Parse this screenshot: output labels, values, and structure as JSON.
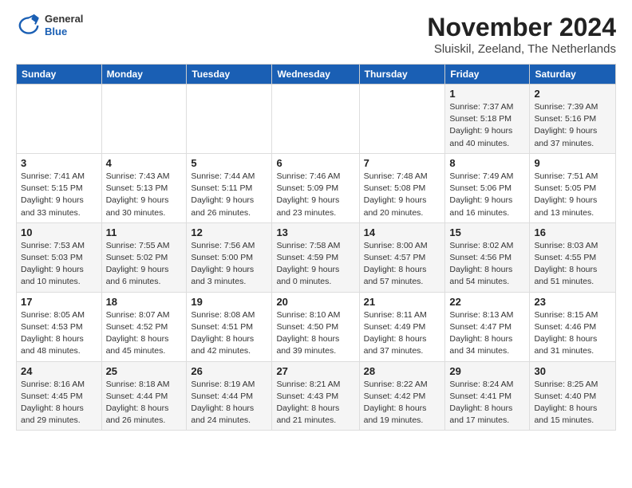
{
  "header": {
    "logo": {
      "general": "General",
      "blue": "Blue"
    },
    "title": "November 2024",
    "subtitle": "Sluiskil, Zeeland, The Netherlands"
  },
  "weekdays": [
    "Sunday",
    "Monday",
    "Tuesday",
    "Wednesday",
    "Thursday",
    "Friday",
    "Saturday"
  ],
  "weeks": [
    [
      {
        "day": "",
        "info": ""
      },
      {
        "day": "",
        "info": ""
      },
      {
        "day": "",
        "info": ""
      },
      {
        "day": "",
        "info": ""
      },
      {
        "day": "",
        "info": ""
      },
      {
        "day": "1",
        "info": "Sunrise: 7:37 AM\nSunset: 5:18 PM\nDaylight: 9 hours\nand 40 minutes."
      },
      {
        "day": "2",
        "info": "Sunrise: 7:39 AM\nSunset: 5:16 PM\nDaylight: 9 hours\nand 37 minutes."
      }
    ],
    [
      {
        "day": "3",
        "info": "Sunrise: 7:41 AM\nSunset: 5:15 PM\nDaylight: 9 hours\nand 33 minutes."
      },
      {
        "day": "4",
        "info": "Sunrise: 7:43 AM\nSunset: 5:13 PM\nDaylight: 9 hours\nand 30 minutes."
      },
      {
        "day": "5",
        "info": "Sunrise: 7:44 AM\nSunset: 5:11 PM\nDaylight: 9 hours\nand 26 minutes."
      },
      {
        "day": "6",
        "info": "Sunrise: 7:46 AM\nSunset: 5:09 PM\nDaylight: 9 hours\nand 23 minutes."
      },
      {
        "day": "7",
        "info": "Sunrise: 7:48 AM\nSunset: 5:08 PM\nDaylight: 9 hours\nand 20 minutes."
      },
      {
        "day": "8",
        "info": "Sunrise: 7:49 AM\nSunset: 5:06 PM\nDaylight: 9 hours\nand 16 minutes."
      },
      {
        "day": "9",
        "info": "Sunrise: 7:51 AM\nSunset: 5:05 PM\nDaylight: 9 hours\nand 13 minutes."
      }
    ],
    [
      {
        "day": "10",
        "info": "Sunrise: 7:53 AM\nSunset: 5:03 PM\nDaylight: 9 hours\nand 10 minutes."
      },
      {
        "day": "11",
        "info": "Sunrise: 7:55 AM\nSunset: 5:02 PM\nDaylight: 9 hours\nand 6 minutes."
      },
      {
        "day": "12",
        "info": "Sunrise: 7:56 AM\nSunset: 5:00 PM\nDaylight: 9 hours\nand 3 minutes."
      },
      {
        "day": "13",
        "info": "Sunrise: 7:58 AM\nSunset: 4:59 PM\nDaylight: 9 hours\nand 0 minutes."
      },
      {
        "day": "14",
        "info": "Sunrise: 8:00 AM\nSunset: 4:57 PM\nDaylight: 8 hours\nand 57 minutes."
      },
      {
        "day": "15",
        "info": "Sunrise: 8:02 AM\nSunset: 4:56 PM\nDaylight: 8 hours\nand 54 minutes."
      },
      {
        "day": "16",
        "info": "Sunrise: 8:03 AM\nSunset: 4:55 PM\nDaylight: 8 hours\nand 51 minutes."
      }
    ],
    [
      {
        "day": "17",
        "info": "Sunrise: 8:05 AM\nSunset: 4:53 PM\nDaylight: 8 hours\nand 48 minutes."
      },
      {
        "day": "18",
        "info": "Sunrise: 8:07 AM\nSunset: 4:52 PM\nDaylight: 8 hours\nand 45 minutes."
      },
      {
        "day": "19",
        "info": "Sunrise: 8:08 AM\nSunset: 4:51 PM\nDaylight: 8 hours\nand 42 minutes."
      },
      {
        "day": "20",
        "info": "Sunrise: 8:10 AM\nSunset: 4:50 PM\nDaylight: 8 hours\nand 39 minutes."
      },
      {
        "day": "21",
        "info": "Sunrise: 8:11 AM\nSunset: 4:49 PM\nDaylight: 8 hours\nand 37 minutes."
      },
      {
        "day": "22",
        "info": "Sunrise: 8:13 AM\nSunset: 4:47 PM\nDaylight: 8 hours\nand 34 minutes."
      },
      {
        "day": "23",
        "info": "Sunrise: 8:15 AM\nSunset: 4:46 PM\nDaylight: 8 hours\nand 31 minutes."
      }
    ],
    [
      {
        "day": "24",
        "info": "Sunrise: 8:16 AM\nSunset: 4:45 PM\nDaylight: 8 hours\nand 29 minutes."
      },
      {
        "day": "25",
        "info": "Sunrise: 8:18 AM\nSunset: 4:44 PM\nDaylight: 8 hours\nand 26 minutes."
      },
      {
        "day": "26",
        "info": "Sunrise: 8:19 AM\nSunset: 4:44 PM\nDaylight: 8 hours\nand 24 minutes."
      },
      {
        "day": "27",
        "info": "Sunrise: 8:21 AM\nSunset: 4:43 PM\nDaylight: 8 hours\nand 21 minutes."
      },
      {
        "day": "28",
        "info": "Sunrise: 8:22 AM\nSunset: 4:42 PM\nDaylight: 8 hours\nand 19 minutes."
      },
      {
        "day": "29",
        "info": "Sunrise: 8:24 AM\nSunset: 4:41 PM\nDaylight: 8 hours\nand 17 minutes."
      },
      {
        "day": "30",
        "info": "Sunrise: 8:25 AM\nSunset: 4:40 PM\nDaylight: 8 hours\nand 15 minutes."
      }
    ]
  ]
}
